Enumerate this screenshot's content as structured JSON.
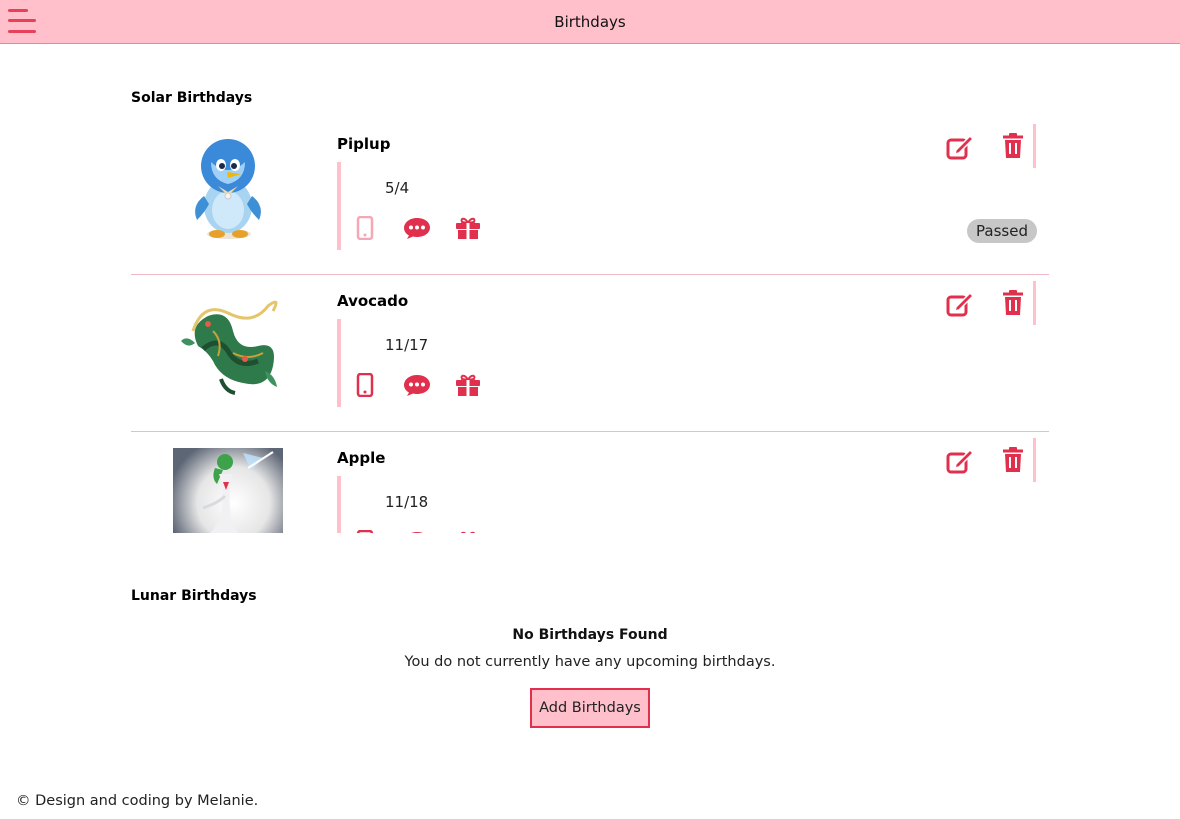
{
  "header": {
    "title": "Birthdays",
    "menu_icon": "hamburger-menu-icon"
  },
  "solar": {
    "title": "Solar Birthdays",
    "items": [
      {
        "name": "Piplup",
        "date": "5/4",
        "status": "Passed",
        "phone_enabled": false,
        "avatar": "piplup-penguin"
      },
      {
        "name": "Avocado",
        "date": "11/17",
        "status": "",
        "phone_enabled": true,
        "avatar": "green-serpent-dragon"
      },
      {
        "name": "Apple",
        "date": "11/18",
        "status": "",
        "phone_enabled": true,
        "avatar": "gardevoir-figure"
      }
    ]
  },
  "lunar": {
    "title": "Lunar Birthdays",
    "empty_title": "No Birthdays Found",
    "empty_text": "You do not currently have any upcoming birthdays.",
    "add_label": "Add Birthdays"
  },
  "footer": {
    "text": "© Design and coding by Melanie."
  },
  "colors": {
    "accent": "#e0304d",
    "header_bg": "#ffc0cb",
    "soft_pink": "#f7a6b6",
    "badge_bg": "#c7c7c7"
  },
  "icons": {
    "edit": "edit-icon",
    "delete": "trash-icon",
    "phone": "phone-icon",
    "message": "message-icon",
    "gift": "gift-icon"
  }
}
